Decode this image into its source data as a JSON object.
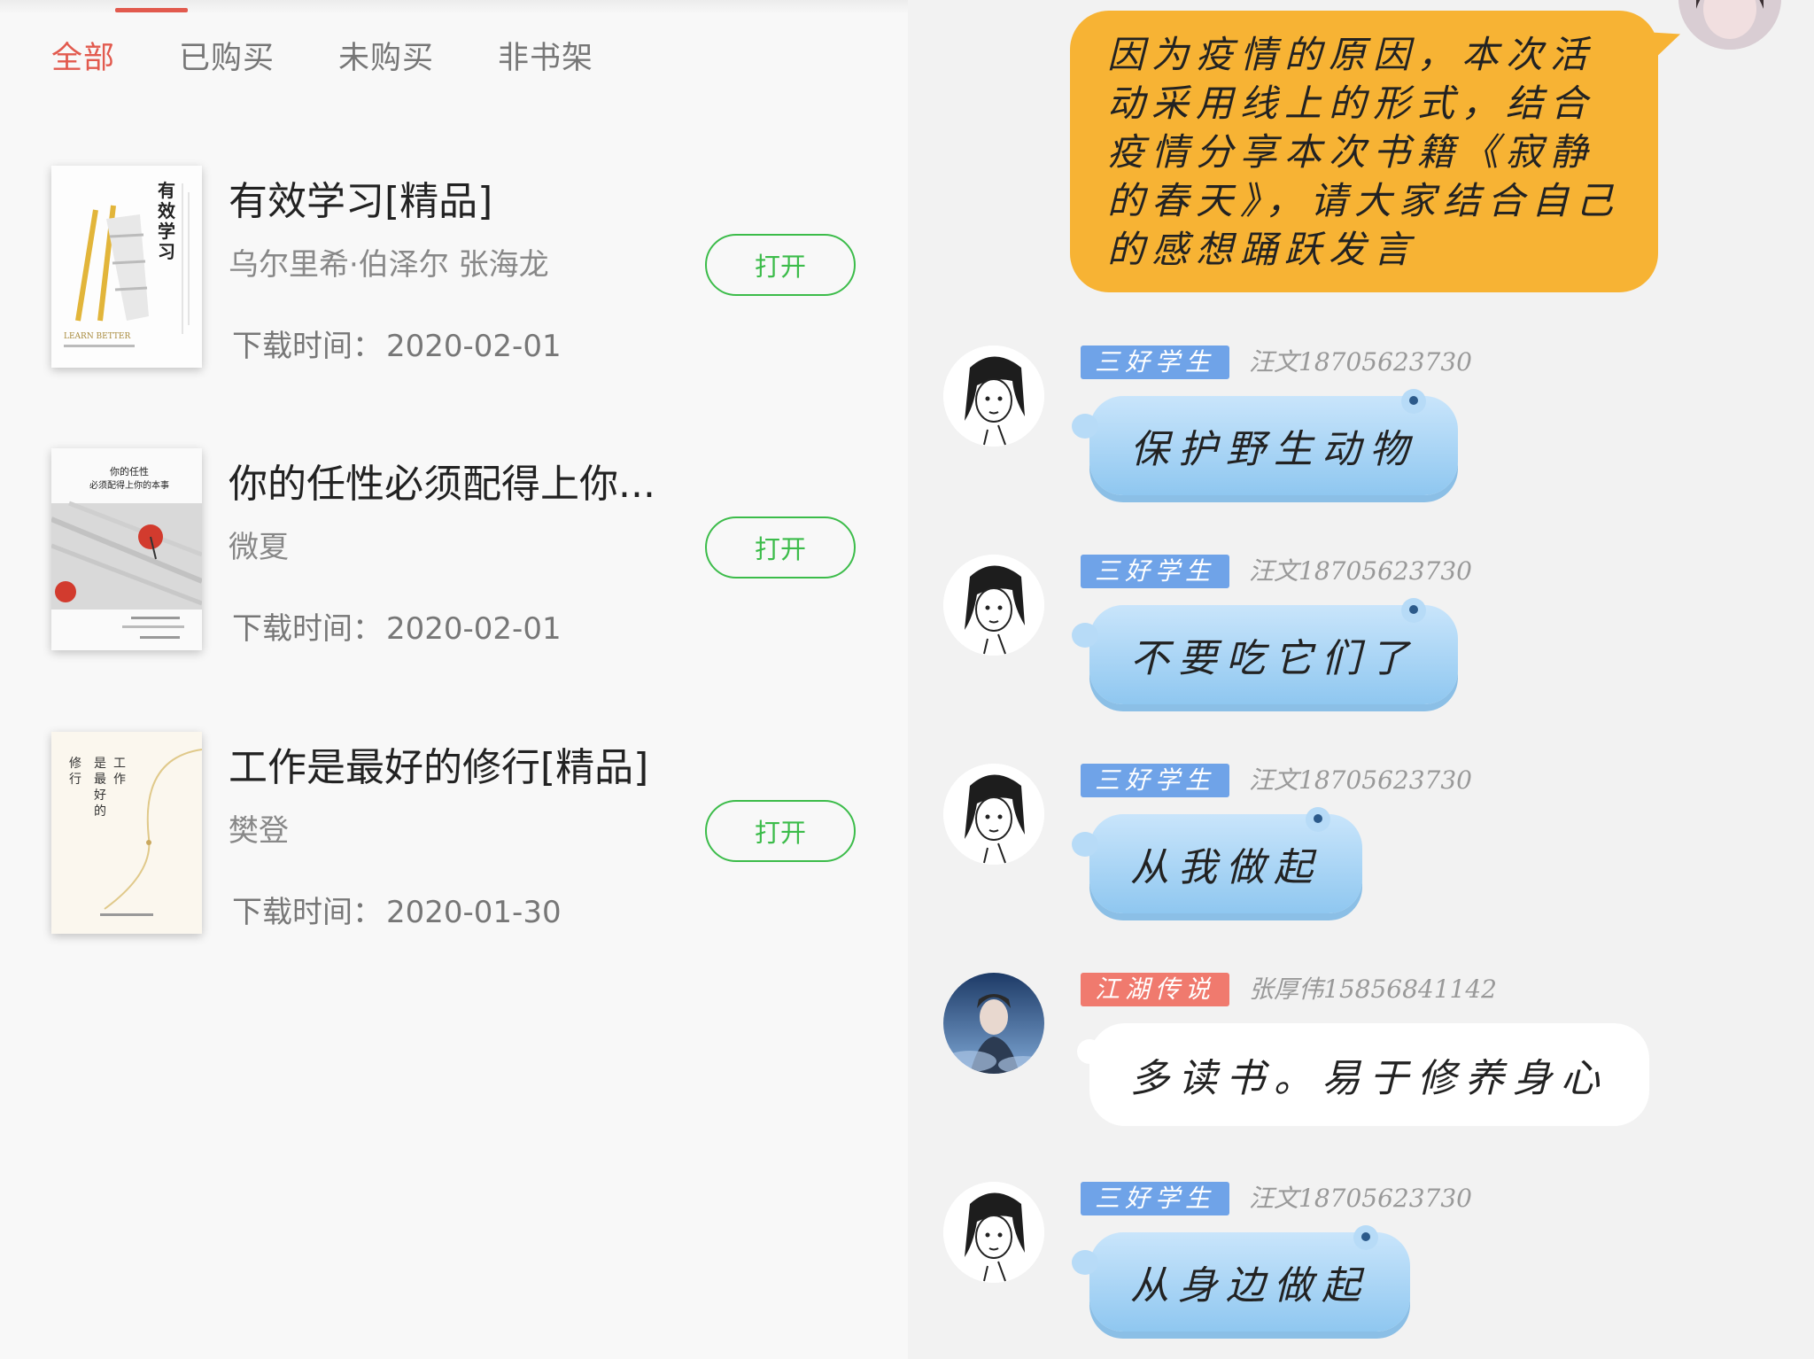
{
  "tabs": [
    "全部",
    "已购买",
    "未购买",
    "非书架"
  ],
  "books": [
    {
      "title": "有效学习[精品]",
      "author": "乌尔里希·伯泽尔 张海龙",
      "date_label": "下载时间：",
      "date": "2020-02-01",
      "button": "打开",
      "cover": {
        "title": "有效学习",
        "subtitle": "LEARN BETTER"
      }
    },
    {
      "title": "你的任性必须配得上你...",
      "author": "微夏",
      "date_label": "下载时间：",
      "date": "2020-02-01",
      "button": "打开",
      "cover": {
        "title": "你的任性\n必须配得上你的本事"
      }
    },
    {
      "title": "工作是最好的修行[精品]",
      "author": "樊登",
      "date_label": "下载时间：",
      "date": "2020-01-30",
      "button": "打开",
      "cover": {
        "title": "工作是最好的修行"
      }
    }
  ],
  "chat": {
    "top_message": "因为疫情的原因，本次活动采用线上的形式，结合疫情分享本次书籍《寂静的春天》，请大家结合自己的感想踊跃发言",
    "messages": [
      {
        "badge": "三好学生",
        "badge_color": "#6fa3e8",
        "sender": "汪文18705623730",
        "text": "保护野生动物"
      },
      {
        "badge": "三好学生",
        "badge_color": "#6fa3e8",
        "sender": "汪文18705623730",
        "text": "不要吃它们了"
      },
      {
        "badge": "三好学生",
        "badge_color": "#6fa3e8",
        "sender": "汪文18705623730",
        "text": "从我做起"
      },
      {
        "badge": "江湖传说",
        "badge_color": "#f07a6e",
        "sender": "张厚伟15856841142",
        "text": "多读书。易于修养身心"
      },
      {
        "badge": "三好学生",
        "badge_color": "#6fa3e8",
        "sender": "汪文18705623730",
        "text": "从身边做起"
      }
    ]
  },
  "colors": {
    "accent": "#e25a4e",
    "open_button": "#3cbc4a",
    "top_bubble": "#f7b334"
  }
}
